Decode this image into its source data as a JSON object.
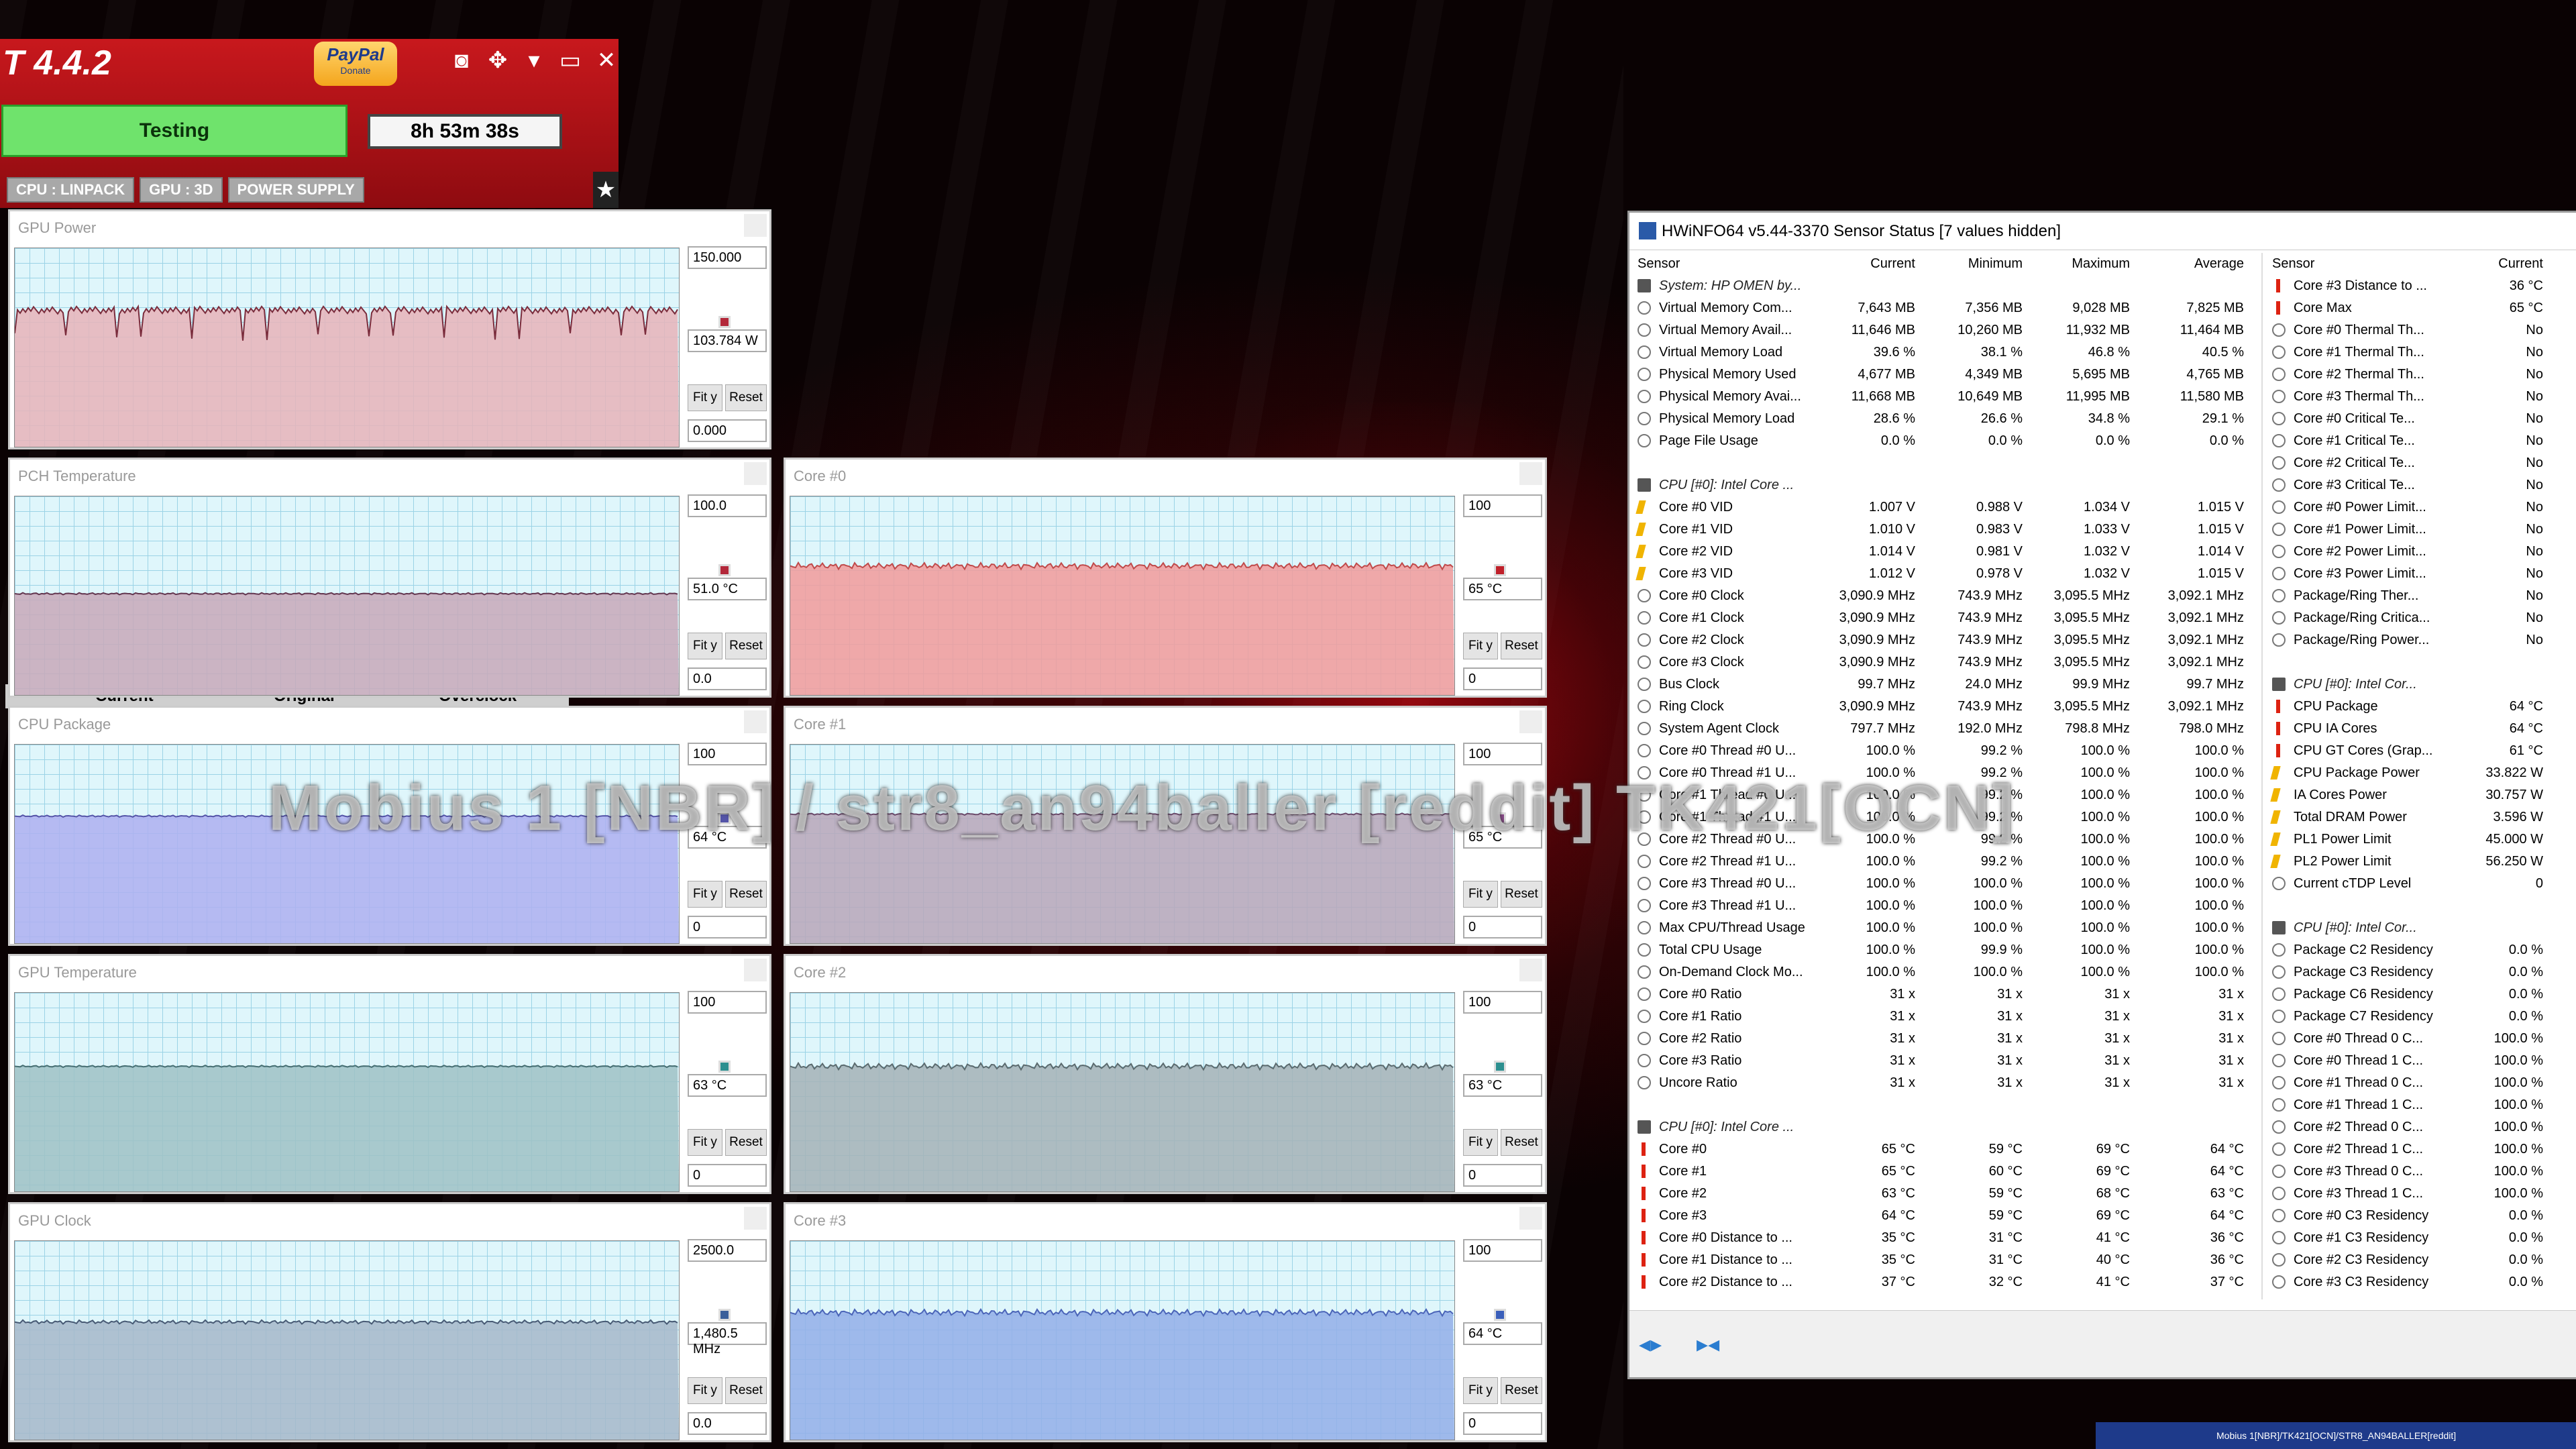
{
  "occt": {
    "title": "T 4.4.2",
    "paypal_text": "PayPal",
    "paypal_sub": "Donate",
    "status": "Testing",
    "timer": "8h 53m 38s",
    "tabs": [
      "CPU : LINPACK",
      "GPU : 3D",
      "POWER SUPPLY"
    ],
    "toolbar_icons": [
      "camera-icon",
      "move-icon",
      "dropdown-icon",
      "minimize-icon",
      "close-icon"
    ]
  },
  "bg_labels": [
    "Current",
    "Original",
    "Overclock"
  ],
  "graphs": [
    {
      "name": "gpu-power",
      "title": "GPU Power",
      "max": "150.000",
      "current": "103.784 W",
      "min": "0.000",
      "level": 0.69,
      "noise": "spiky",
      "fill": "#e7b3b9",
      "line": "#7a2c3c",
      "dot": "#b3283a"
    },
    {
      "name": "pch-temperature",
      "title": "PCH Temperature",
      "max": "100.0",
      "current": "51.0 °C",
      "min": "0.0",
      "level": 0.51,
      "noise": "flat",
      "fill": "#c8a8b8",
      "line": "#62354e",
      "dot": "#b3283a"
    },
    {
      "name": "cpu-package",
      "title": "CPU Package",
      "max": "100",
      "current": "64 °C",
      "min": "0",
      "level": 0.64,
      "noise": "flat",
      "fill": "#aeaff0",
      "line": "#5454a8",
      "dot": "#5454a8"
    },
    {
      "name": "gpu-temperature",
      "title": "GPU Temperature",
      "max": "100",
      "current": "63 °C",
      "min": "0",
      "level": 0.63,
      "noise": "flat",
      "fill": "#9fc1c4",
      "line": "#466e72",
      "dot": "#2c8f8f"
    },
    {
      "name": "gpu-clock",
      "title": "GPU Clock",
      "max": "2500.0",
      "current": "1,480.5 MHz",
      "min": "0.0",
      "level": 0.5922,
      "noise": "light",
      "fill": "#a6b7c9",
      "line": "#475a74",
      "dot": "#3a5f9a"
    },
    {
      "name": "core-0",
      "title": "Core #0",
      "max": "100",
      "current": "65 °C",
      "min": "0",
      "level": 0.65,
      "noise": "med",
      "fill": "#f29a9a",
      "line": "#c04a4a",
      "dot": "#c0202a"
    },
    {
      "name": "core-1",
      "title": "Core #1",
      "max": "100",
      "current": "65 °C",
      "min": "0",
      "level": 0.65,
      "noise": "flat",
      "fill": "#b9a6b9",
      "line": "#6a4a6a",
      "dot": "#8a4a8a"
    },
    {
      "name": "core-2",
      "title": "Core #2",
      "max": "100",
      "current": "63 °C",
      "min": "0",
      "level": 0.63,
      "noise": "med",
      "fill": "#a4b2b6",
      "line": "#5a6a6e",
      "dot": "#2c8f8f"
    },
    {
      "name": "core-3",
      "title": "Core #3",
      "max": "100",
      "current": "64 °C",
      "min": "0",
      "level": 0.64,
      "noise": "med",
      "fill": "#93aee8",
      "line": "#4a64b8",
      "dot": "#3a5fba"
    }
  ],
  "graph_buttons": {
    "fit": "Fit y",
    "reset": "Reset"
  },
  "hwinfo": {
    "title": "HWiNFO64 v5.44-3370 Sensor Status [7 values hidden]",
    "headers": [
      "Sensor",
      "Current",
      "Minimum",
      "Maximum",
      "Average"
    ],
    "rows": [
      {
        "t": "grp",
        "icon": "sys",
        "s": "System: HP OMEN by..."
      },
      {
        "icon": "mem",
        "s": "Virtual Memory Com...",
        "c": "7,643 MB",
        "mi": "7,356 MB",
        "ma": "9,028 MB",
        "a": "7,825 MB"
      },
      {
        "icon": "mem",
        "s": "Virtual Memory Avail...",
        "c": "11,646 MB",
        "mi": "10,260 MB",
        "ma": "11,932 MB",
        "a": "11,464 MB"
      },
      {
        "icon": "mem",
        "s": "Virtual Memory Load",
        "c": "39.6 %",
        "mi": "38.1 %",
        "ma": "46.8 %",
        "a": "40.5 %"
      },
      {
        "icon": "mem",
        "s": "Physical Memory Used",
        "c": "4,677 MB",
        "mi": "4,349 MB",
        "ma": "5,695 MB",
        "a": "4,765 MB"
      },
      {
        "icon": "mem",
        "s": "Physical Memory Avai...",
        "c": "11,668 MB",
        "mi": "10,649 MB",
        "ma": "11,995 MB",
        "a": "11,580 MB"
      },
      {
        "icon": "mem",
        "s": "Physical Memory Load",
        "c": "28.6 %",
        "mi": "26.6 %",
        "ma": "34.8 %",
        "a": "29.1 %"
      },
      {
        "icon": "mem",
        "s": "Page File Usage",
        "c": "0.0 %",
        "mi": "0.0 %",
        "ma": "0.0 %",
        "a": "0.0 %"
      },
      {
        "t": "blank"
      },
      {
        "t": "grp",
        "icon": "sys",
        "s": "CPU [#0]: Intel Core ..."
      },
      {
        "icon": "volt",
        "s": "Core #0 VID",
        "c": "1.007 V",
        "mi": "0.988 V",
        "ma": "1.034 V",
        "a": "1.015 V"
      },
      {
        "icon": "volt",
        "s": "Core #1 VID",
        "c": "1.010 V",
        "mi": "0.983 V",
        "ma": "1.033 V",
        "a": "1.015 V"
      },
      {
        "icon": "volt",
        "s": "Core #2 VID",
        "c": "1.014 V",
        "mi": "0.981 V",
        "ma": "1.032 V",
        "a": "1.014 V"
      },
      {
        "icon": "volt",
        "s": "Core #3 VID",
        "c": "1.012 V",
        "mi": "0.978 V",
        "ma": "1.032 V",
        "a": "1.015 V"
      },
      {
        "icon": "clk",
        "s": "Core #0 Clock",
        "c": "3,090.9 MHz",
        "mi": "743.9 MHz",
        "ma": "3,095.5 MHz",
        "a": "3,092.1 MHz"
      },
      {
        "icon": "clk",
        "s": "Core #1 Clock",
        "c": "3,090.9 MHz",
        "mi": "743.9 MHz",
        "ma": "3,095.5 MHz",
        "a": "3,092.1 MHz"
      },
      {
        "icon": "clk",
        "s": "Core #2 Clock",
        "c": "3,090.9 MHz",
        "mi": "743.9 MHz",
        "ma": "3,095.5 MHz",
        "a": "3,092.1 MHz"
      },
      {
        "icon": "clk",
        "s": "Core #3 Clock",
        "c": "3,090.9 MHz",
        "mi": "743.9 MHz",
        "ma": "3,095.5 MHz",
        "a": "3,092.1 MHz"
      },
      {
        "icon": "clk",
        "s": "Bus Clock",
        "c": "99.7 MHz",
        "mi": "24.0 MHz",
        "ma": "99.9 MHz",
        "a": "99.7 MHz"
      },
      {
        "icon": "clk",
        "s": "Ring Clock",
        "c": "3,090.9 MHz",
        "mi": "743.9 MHz",
        "ma": "3,095.5 MHz",
        "a": "3,092.1 MHz"
      },
      {
        "icon": "clk",
        "s": "System Agent Clock",
        "c": "797.7 MHz",
        "mi": "192.0 MHz",
        "ma": "798.8 MHz",
        "a": "798.0 MHz"
      },
      {
        "icon": "clk",
        "s": "Core #0 Thread #0 U...",
        "c": "100.0 %",
        "mi": "99.2 %",
        "ma": "100.0 %",
        "a": "100.0 %"
      },
      {
        "icon": "clk",
        "s": "Core #0 Thread #1 U...",
        "c": "100.0 %",
        "mi": "99.2 %",
        "ma": "100.0 %",
        "a": "100.0 %"
      },
      {
        "icon": "clk",
        "s": "Core #1 Thread #0 U...",
        "c": "100.0 %",
        "mi": "99.2 %",
        "ma": "100.0 %",
        "a": "100.0 %"
      },
      {
        "icon": "clk",
        "s": "Core #1 Thread #1 U...",
        "c": "100.0 %",
        "mi": "99.2 %",
        "ma": "100.0 %",
        "a": "100.0 %"
      },
      {
        "icon": "clk",
        "s": "Core #2 Thread #0 U...",
        "c": "100.0 %",
        "mi": "99.2 %",
        "ma": "100.0 %",
        "a": "100.0 %"
      },
      {
        "icon": "clk",
        "s": "Core #2 Thread #1 U...",
        "c": "100.0 %",
        "mi": "99.2 %",
        "ma": "100.0 %",
        "a": "100.0 %"
      },
      {
        "icon": "clk",
        "s": "Core #3 Thread #0 U...",
        "c": "100.0 %",
        "mi": "100.0 %",
        "ma": "100.0 %",
        "a": "100.0 %"
      },
      {
        "icon": "clk",
        "s": "Core #3 Thread #1 U...",
        "c": "100.0 %",
        "mi": "100.0 %",
        "ma": "100.0 %",
        "a": "100.0 %"
      },
      {
        "icon": "clk",
        "s": "Max CPU/Thread Usage",
        "c": "100.0 %",
        "mi": "100.0 %",
        "ma": "100.0 %",
        "a": "100.0 %"
      },
      {
        "icon": "clk",
        "s": "Total CPU Usage",
        "c": "100.0 %",
        "mi": "99.9 %",
        "ma": "100.0 %",
        "a": "100.0 %"
      },
      {
        "icon": "clk",
        "s": "On-Demand Clock Mo...",
        "c": "100.0 %",
        "mi": "100.0 %",
        "ma": "100.0 %",
        "a": "100.0 %"
      },
      {
        "icon": "clk",
        "s": "Core #0 Ratio",
        "c": "31 x",
        "mi": "31 x",
        "ma": "31 x",
        "a": "31 x"
      },
      {
        "icon": "clk",
        "s": "Core #1 Ratio",
        "c": "31 x",
        "mi": "31 x",
        "ma": "31 x",
        "a": "31 x"
      },
      {
        "icon": "clk",
        "s": "Core #2 Ratio",
        "c": "31 x",
        "mi": "31 x",
        "ma": "31 x",
        "a": "31 x"
      },
      {
        "icon": "clk",
        "s": "Core #3 Ratio",
        "c": "31 x",
        "mi": "31 x",
        "ma": "31 x",
        "a": "31 x"
      },
      {
        "icon": "clk",
        "s": "Uncore Ratio",
        "c": "31 x",
        "mi": "31 x",
        "ma": "31 x",
        "a": "31 x"
      },
      {
        "t": "blank"
      },
      {
        "t": "grp",
        "icon": "sys",
        "s": "CPU [#0]: Intel Core ..."
      },
      {
        "icon": "therm",
        "s": "Core #0",
        "c": "65 °C",
        "mi": "59 °C",
        "ma": "69 °C",
        "a": "64 °C"
      },
      {
        "icon": "therm",
        "s": "Core #1",
        "c": "65 °C",
        "mi": "60 °C",
        "ma": "69 °C",
        "a": "64 °C"
      },
      {
        "icon": "therm",
        "s": "Core #2",
        "c": "63 °C",
        "mi": "59 °C",
        "ma": "68 °C",
        "a": "63 °C"
      },
      {
        "icon": "therm",
        "s": "Core #3",
        "c": "64 °C",
        "mi": "59 °C",
        "ma": "69 °C",
        "a": "64 °C"
      },
      {
        "icon": "therm",
        "s": "Core #0 Distance to ...",
        "c": "35 °C",
        "mi": "31 °C",
        "ma": "41 °C",
        "a": "36 °C"
      },
      {
        "icon": "therm",
        "s": "Core #1 Distance to ...",
        "c": "35 °C",
        "mi": "31 °C",
        "ma": "40 °C",
        "a": "36 °C"
      },
      {
        "icon": "therm",
        "s": "Core #2 Distance to ...",
        "c": "37 °C",
        "mi": "32 °C",
        "ma": "41 °C",
        "a": "37 °C"
      }
    ],
    "right_headers": [
      "Sensor",
      "Current"
    ],
    "right_rows": [
      {
        "icon": "therm",
        "s": "Core #3 Distance to ...",
        "c": "36 °C"
      },
      {
        "icon": "therm",
        "s": "Core Max",
        "c": "65 °C"
      },
      {
        "icon": "clk",
        "s": "Core #0 Thermal Th...",
        "c": "No"
      },
      {
        "icon": "clk",
        "s": "Core #1 Thermal Th...",
        "c": "No"
      },
      {
        "icon": "clk",
        "s": "Core #2 Thermal Th...",
        "c": "No"
      },
      {
        "icon": "clk",
        "s": "Core #3 Thermal Th...",
        "c": "No"
      },
      {
        "icon": "clk",
        "s": "Core #0 Critical Te...",
        "c": "No"
      },
      {
        "icon": "clk",
        "s": "Core #1 Critical Te...",
        "c": "No"
      },
      {
        "icon": "clk",
        "s": "Core #2 Critical Te...",
        "c": "No"
      },
      {
        "icon": "clk",
        "s": "Core #3 Critical Te...",
        "c": "No"
      },
      {
        "icon": "clk",
        "s": "Core #0 Power Limit...",
        "c": "No"
      },
      {
        "icon": "clk",
        "s": "Core #1 Power Limit...",
        "c": "No"
      },
      {
        "icon": "clk",
        "s": "Core #2 Power Limit...",
        "c": "No"
      },
      {
        "icon": "clk",
        "s": "Core #3 Power Limit...",
        "c": "No"
      },
      {
        "icon": "clk",
        "s": "Package/Ring Ther...",
        "c": "No"
      },
      {
        "icon": "clk",
        "s": "Package/Ring Critica...",
        "c": "No"
      },
      {
        "icon": "clk",
        "s": "Package/Ring Power...",
        "c": "No"
      },
      {
        "t": "blank"
      },
      {
        "t": "grp",
        "icon": "sys",
        "s": "CPU [#0]: Intel Cor..."
      },
      {
        "icon": "therm",
        "s": "CPU Package",
        "c": "64 °C"
      },
      {
        "icon": "therm",
        "s": "CPU IA Cores",
        "c": "64 °C"
      },
      {
        "icon": "therm",
        "s": "CPU GT Cores (Grap...",
        "c": "61 °C"
      },
      {
        "icon": "volt",
        "s": "CPU Package Power",
        "c": "33.822 W"
      },
      {
        "icon": "volt",
        "s": "IA Cores Power",
        "c": "30.757 W"
      },
      {
        "icon": "volt",
        "s": "Total DRAM Power",
        "c": "3.596 W"
      },
      {
        "icon": "volt",
        "s": "PL1 Power Limit",
        "c": "45.000 W"
      },
      {
        "icon": "volt",
        "s": "PL2 Power Limit",
        "c": "56.250 W"
      },
      {
        "icon": "clk",
        "s": "Current cTDP Level",
        "c": "0"
      },
      {
        "t": "blank"
      },
      {
        "t": "grp",
        "icon": "sys",
        "s": "CPU [#0]: Intel Cor..."
      },
      {
        "icon": "clk",
        "s": "Package C2 Residency",
        "c": "0.0 %"
      },
      {
        "icon": "clk",
        "s": "Package C3 Residency",
        "c": "0.0 %"
      },
      {
        "icon": "clk",
        "s": "Package C6 Residency",
        "c": "0.0 %"
      },
      {
        "icon": "clk",
        "s": "Package C7 Residency",
        "c": "0.0 %"
      },
      {
        "icon": "clk",
        "s": "Core #0 Thread 0 C...",
        "c": "100.0 %"
      },
      {
        "icon": "clk",
        "s": "Core #0 Thread 1 C...",
        "c": "100.0 %"
      },
      {
        "icon": "clk",
        "s": "Core #1 Thread 0 C...",
        "c": "100.0 %"
      },
      {
        "icon": "clk",
        "s": "Core #1 Thread 1 C...",
        "c": "100.0 %"
      },
      {
        "icon": "clk",
        "s": "Core #2 Thread 0 C...",
        "c": "100.0 %"
      },
      {
        "icon": "clk",
        "s": "Core #2 Thread 1 C...",
        "c": "100.0 %"
      },
      {
        "icon": "clk",
        "s": "Core #3 Thread 0 C...",
        "c": "100.0 %"
      },
      {
        "icon": "clk",
        "s": "Core #3 Thread 1 C...",
        "c": "100.0 %"
      },
      {
        "icon": "clk",
        "s": "Core #0 C3 Residency",
        "c": "0.0 %"
      },
      {
        "icon": "clk",
        "s": "Core #1 C3 Residency",
        "c": "0.0 %"
      },
      {
        "icon": "clk",
        "s": "Core #2 C3 Residency",
        "c": "0.0 %"
      },
      {
        "icon": "clk",
        "s": "Core #3 C3 Residency",
        "c": "0.0 %"
      }
    ],
    "nav_icons": [
      "nav-back-icon",
      "nav-forward-icon"
    ]
  },
  "watermark": "Mobius 1 [NBR] / str8_an94baller [reddit] TK421[OCN]",
  "taskbar_text": "Mobius 1[NBR]/TK421[OCN]/STR8_AN94BALLER[reddit]"
}
